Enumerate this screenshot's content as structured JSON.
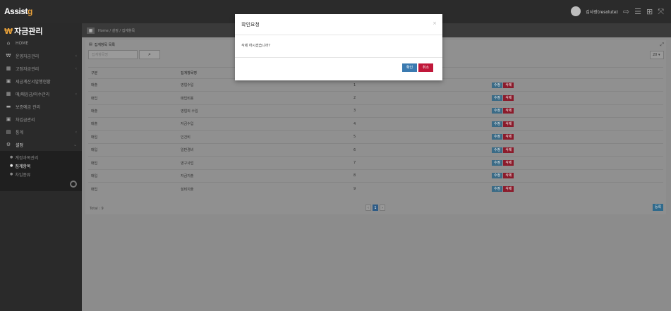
{
  "app": {
    "logo_main": "Assist",
    "logo_accent": "g",
    "brand_icon": "₩",
    "brand_title": "자금관리"
  },
  "topbar": {
    "user_name": "김사장(resolute)",
    "icons": [
      "logout-icon",
      "menu-icon",
      "grid-icon",
      "fullscreen-icon"
    ]
  },
  "sidebar": {
    "items": [
      {
        "icon": "home-icon",
        "label": "HOME"
      },
      {
        "icon": "won-icon",
        "label": "운영자금관리"
      },
      {
        "icon": "calendar-icon",
        "label": "고정자금관리"
      },
      {
        "icon": "tax-icon",
        "label": "세금계산서발행현황"
      },
      {
        "icon": "calendar-icon",
        "label": "매/매입금/미수관리"
      },
      {
        "icon": "card-icon",
        "label": "보증예금 관리"
      },
      {
        "icon": "tax-icon",
        "label": "차입금관리"
      },
      {
        "icon": "chart-icon",
        "label": "통계"
      },
      {
        "icon": "settings-icon",
        "label": "설정"
      }
    ],
    "submenu": [
      {
        "label": "계정과목관리"
      },
      {
        "label": "집계항목"
      },
      {
        "label": "차입종류"
      }
    ]
  },
  "breadcrumb": {
    "text": "Home / 설정 / 집계항목"
  },
  "panel": {
    "title": "집계항목 목록",
    "search_placeholder": "집계항목명",
    "page_size": "20",
    "columns": [
      "구분",
      "집계항목명",
      "",
      ""
    ],
    "rows": [
      {
        "type": "매출",
        "name": "영업수입",
        "no": "1"
      },
      {
        "type": "매입",
        "name": "매입비용",
        "no": "2"
      },
      {
        "type": "매출",
        "name": "영업외 수입",
        "no": "3"
      },
      {
        "type": "매출",
        "name": "자금수입",
        "no": "4"
      },
      {
        "type": "매입",
        "name": "인건비",
        "no": "5"
      },
      {
        "type": "매입",
        "name": "일반경비",
        "no": "6"
      },
      {
        "type": "매입",
        "name": "영구사업",
        "no": "7"
      },
      {
        "type": "매입",
        "name": "자금지출",
        "no": "8"
      },
      {
        "type": "매입",
        "name": "설비지출",
        "no": "9"
      }
    ],
    "edit_label": "수정",
    "delete_label": "삭제",
    "total": "Total : 9",
    "pages": [
      "‹",
      "1",
      "›"
    ],
    "current_page": "1",
    "register_label": "등록"
  },
  "modal": {
    "title": "확인요청",
    "message": "삭제 하시겠습니까?",
    "ok_label": "확인",
    "cancel_label": "취소",
    "close_glyph": "×"
  }
}
